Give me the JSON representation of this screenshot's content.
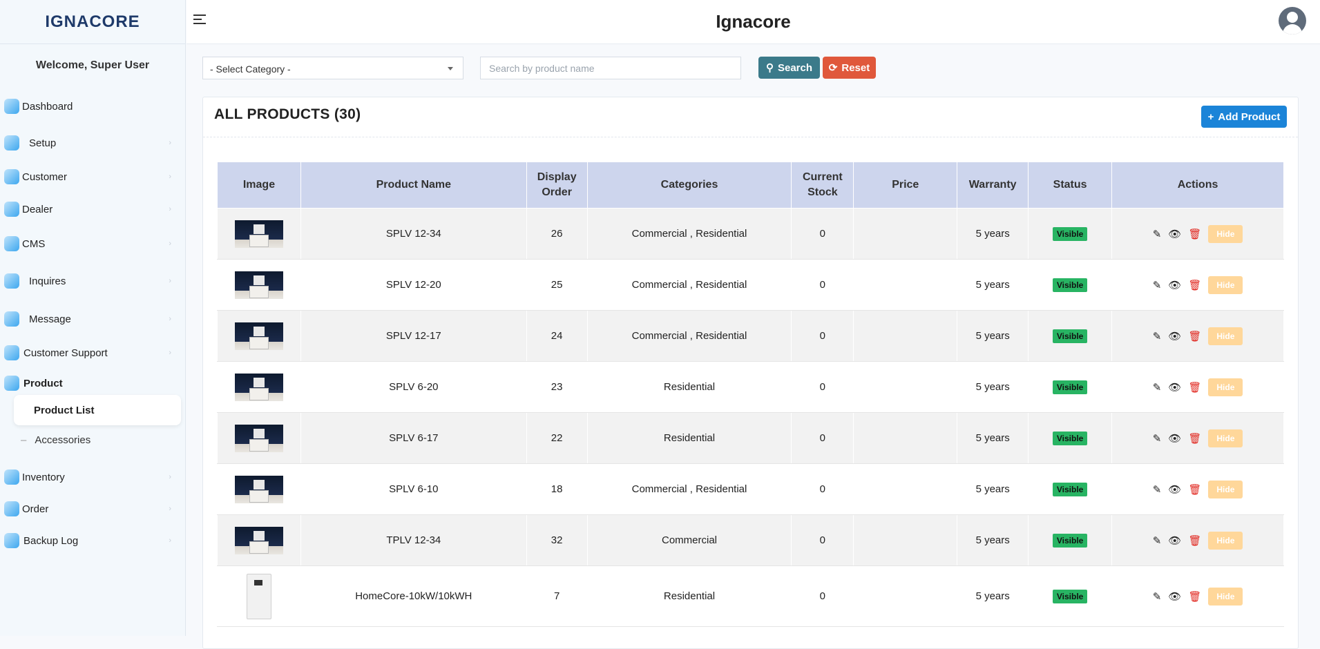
{
  "app": {
    "title": "Ignacore",
    "logo": "IGNACORE"
  },
  "sidebar": {
    "welcome": "Welcome, Super User",
    "items": [
      {
        "label": "Dashboard",
        "icon": "dashboard-icon"
      },
      {
        "label": "Setup",
        "icon": "gear-icon"
      },
      {
        "label": "Customer",
        "icon": "users-icon"
      },
      {
        "label": "Dealer",
        "icon": "dealer-icon"
      },
      {
        "label": "CMS",
        "icon": "cms-icon"
      },
      {
        "label": "Inquires",
        "icon": "chat-icon"
      },
      {
        "label": "Message",
        "icon": "message-icon"
      },
      {
        "label": "Customer Support",
        "icon": "support-icon"
      },
      {
        "label": "Product",
        "icon": "product-icon"
      },
      {
        "label": "Inventory",
        "icon": "inventory-icon"
      },
      {
        "label": "Order",
        "icon": "cart-icon"
      },
      {
        "label": "Backup Log",
        "icon": "backup-icon"
      }
    ],
    "product_sub": {
      "active": "Product List",
      "other": "Accessories"
    }
  },
  "filters": {
    "category_selected": "- Select Category -",
    "search_placeholder": "Search by product name",
    "search_label": "Search",
    "reset_label": "Reset"
  },
  "products": {
    "title": "ALL PRODUCTS (30)",
    "add_label": "Add Product",
    "columns": [
      "Image",
      "Product Name",
      "Display Order",
      "Categories",
      "Current Stock",
      "Price",
      "Warranty",
      "Status",
      "Actions"
    ],
    "rows": [
      {
        "name": "SPLV 12-34",
        "order": "26",
        "categories": "Commercial , Residential",
        "stock": "0",
        "price": "",
        "warranty": "5 years",
        "status": "Visible",
        "hide": "Hide"
      },
      {
        "name": "SPLV 12-20",
        "order": "25",
        "categories": "Commercial , Residential",
        "stock": "0",
        "price": "",
        "warranty": "5 years",
        "status": "Visible",
        "hide": "Hide"
      },
      {
        "name": "SPLV 12-17",
        "order": "24",
        "categories": "Commercial , Residential",
        "stock": "0",
        "price": "",
        "warranty": "5 years",
        "status": "Visible",
        "hide": "Hide"
      },
      {
        "name": "SPLV 6-20",
        "order": "23",
        "categories": "Residential",
        "stock": "0",
        "price": "",
        "warranty": "5 years",
        "status": "Visible",
        "hide": "Hide"
      },
      {
        "name": "SPLV 6-17",
        "order": "22",
        "categories": "Residential",
        "stock": "0",
        "price": "",
        "warranty": "5 years",
        "status": "Visible",
        "hide": "Hide"
      },
      {
        "name": "SPLV 6-10",
        "order": "18",
        "categories": "Commercial , Residential",
        "stock": "0",
        "price": "",
        "warranty": "5 years",
        "status": "Visible",
        "hide": "Hide"
      },
      {
        "name": "TPLV 12-34",
        "order": "32",
        "categories": "Commercial",
        "stock": "0",
        "price": "",
        "warranty": "5 years",
        "status": "Visible",
        "hide": "Hide"
      },
      {
        "name": "HomeCore-10kW/10kWH",
        "order": "7",
        "categories": "Residential",
        "stock": "0",
        "price": "",
        "warranty": "5 years",
        "status": "Visible",
        "hide": "Hide"
      }
    ]
  },
  "colors": {
    "accent": "#1b84d8",
    "visible_badge": "#28b463",
    "hide_btn": "#ffd79a",
    "header_bg": "#cdd5ed"
  }
}
